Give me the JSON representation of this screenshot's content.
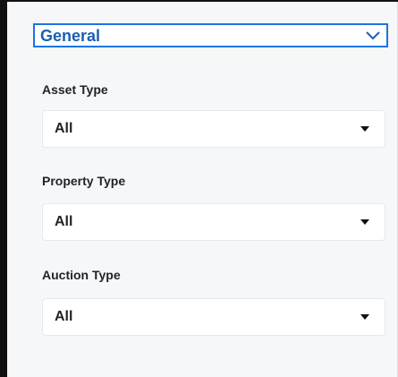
{
  "filters": {
    "section_title": "General",
    "fields": [
      {
        "label": "Asset Type",
        "value": "All"
      },
      {
        "label": "Property Type",
        "value": "All"
      },
      {
        "label": "Auction Type",
        "value": "All"
      }
    ]
  },
  "icons": {
    "section_toggle": "chevron-down-icon",
    "select_caret": "caret-down-icon"
  },
  "colors": {
    "accent": "#1a73e8",
    "title": "#1a5fb4",
    "panel_bg": "#f6f7f9"
  }
}
